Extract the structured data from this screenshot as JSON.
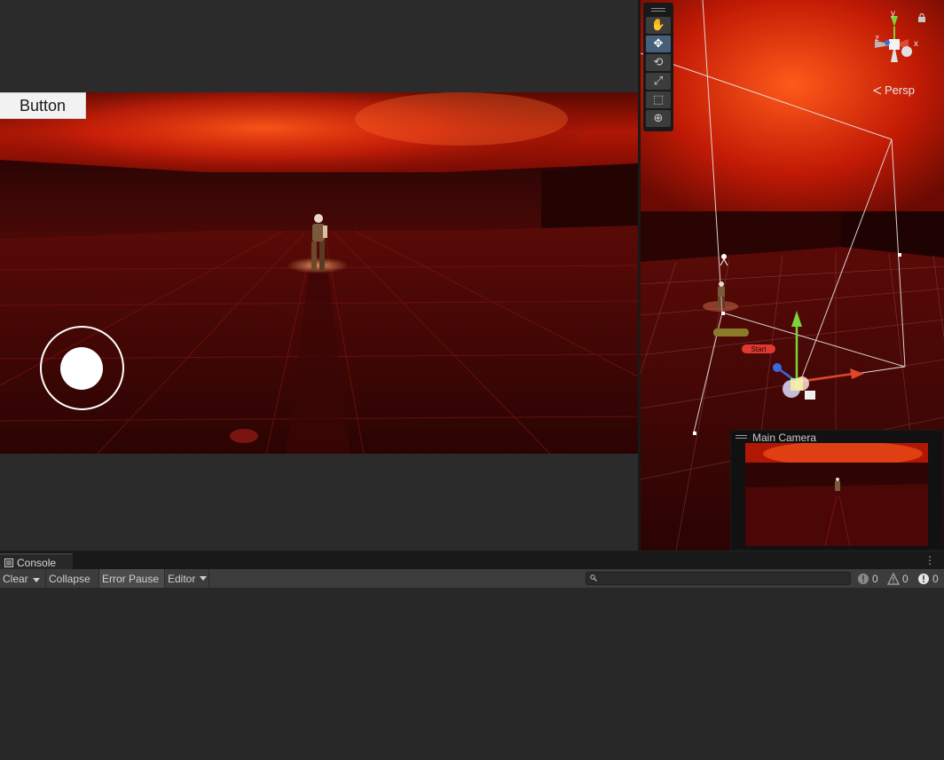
{
  "game": {
    "button_label": "Button"
  },
  "scene": {
    "projection_label": "Persp",
    "axes": {
      "x": "x",
      "y": "y",
      "z": "z"
    },
    "tools": [
      {
        "name": "hand-tool-icon",
        "glyph": "✋",
        "active": false
      },
      {
        "name": "move-tool-icon",
        "glyph": "✥",
        "active": true
      },
      {
        "name": "rotate-tool-icon",
        "glyph": "⟲",
        "active": false
      },
      {
        "name": "scale-tool-icon",
        "glyph": "⤢",
        "active": false
      },
      {
        "name": "rect-tool-icon",
        "glyph": "⬚",
        "active": false
      },
      {
        "name": "transform-tool-icon",
        "glyph": "⊕",
        "active": false
      }
    ],
    "labels": {
      "start_tag": "Start"
    },
    "camera_preview_title": "Main Camera"
  },
  "console": {
    "tab_label": "Console",
    "toolbar": {
      "clear": "Clear",
      "collapse": "Collapse",
      "error_pause": "Error Pause",
      "editor": "Editor"
    },
    "search": {
      "value": "",
      "placeholder": ""
    },
    "counts": {
      "info": "0",
      "warnings": "0",
      "errors": "0"
    }
  },
  "colors": {
    "editor_bg": "#282828",
    "toolbar_bg": "#3c3c3c",
    "active_tool": "#46607c",
    "sky_red": "#c41a06",
    "floor_red": "#4a0605"
  }
}
